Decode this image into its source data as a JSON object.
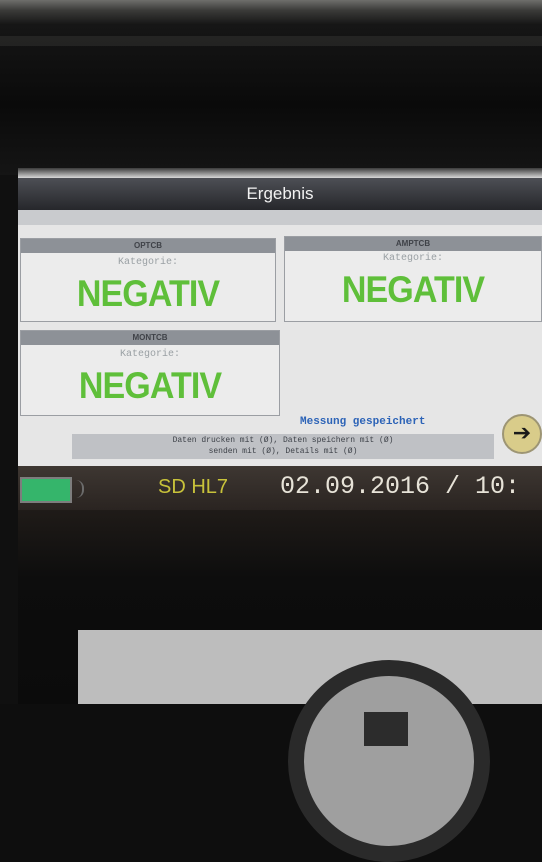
{
  "window": {
    "title": "Ergebnis"
  },
  "subtabs": [
    "",
    "",
    ""
  ],
  "panels": [
    {
      "header": "OPTCB",
      "category_label": "Kategorie:",
      "result": "NEGATIV"
    },
    {
      "header": "AMPTCB",
      "category_label": "Kategorie:",
      "result": "NEGATIV"
    },
    {
      "header": "MONTCB",
      "category_label": "Kategorie:",
      "result": "NEGATIV"
    }
  ],
  "status_message": "Messung gespeichert",
  "hint_text": {
    "line1": "Daten drucken mit (Ø), Daten speichern mit (Ø)",
    "line2": "senden mit (Ø), Details mit (Ø)"
  },
  "statusbar": {
    "sd_label": "SD HL7",
    "datetime": "02.09.2016 / 10:"
  },
  "colors": {
    "result_green": "#5fbf3a",
    "message_blue": "#2c63b7",
    "battery_green": "#35b56b"
  },
  "icons": {
    "next": "arrow-right-icon",
    "battery": "battery-icon"
  }
}
